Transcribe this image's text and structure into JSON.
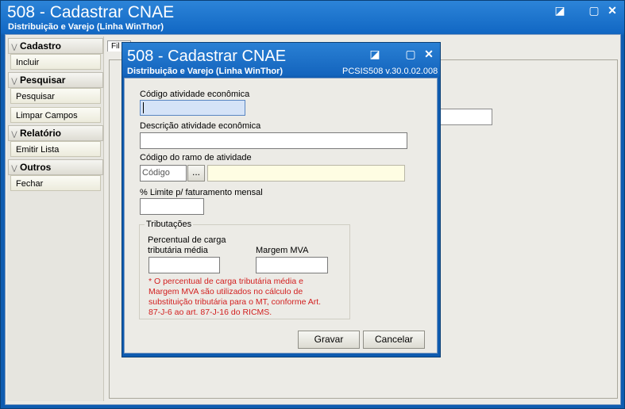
{
  "main_window": {
    "title": "508 - Cadastrar CNAE",
    "subtitle": "Distribuição e Varejo (Linha WinThor)",
    "controls": {
      "restore": "◪",
      "minimize": "▢",
      "close": "✕"
    }
  },
  "sidebar": {
    "groups": [
      {
        "title": "Cadastro",
        "items": [
          "Incluir"
        ]
      },
      {
        "title": "Pesquisar",
        "items": [
          "Pesquisar",
          "Limpar Campos"
        ]
      },
      {
        "title": "Relatório",
        "items": [
          "Emitir Lista"
        ]
      },
      {
        "title": "Outros",
        "items": [
          "Fechar"
        ]
      }
    ]
  },
  "background": {
    "tab_label": "Fil"
  },
  "dialog": {
    "title": "508 - Cadastrar CNAE",
    "subtitle": "Distribuição e Varejo (Linha WinThor)",
    "version": "PCSIS508  v.30.0.02.008",
    "controls": {
      "restore": "◪",
      "minimize": "▢",
      "close": "✕"
    },
    "fields": {
      "codigo_atividade": {
        "label": "Código atividade econômica",
        "value": ""
      },
      "descricao_atividade": {
        "label": "Descrição atividade econômica",
        "value": ""
      },
      "codigo_ramo": {
        "label": "Código do ramo de atividade",
        "placeholder": "Código",
        "lookup_label": "...",
        "desc_value": ""
      },
      "limite_faturamento": {
        "label": "% Limite p/ faturamento mensal",
        "value": ""
      }
    },
    "tributacoes": {
      "legend": "Tributações",
      "percentual_label_1": "Percentual de carga",
      "percentual_label_2": "tributária média",
      "margem_label": "Margem MVA",
      "warning": "* O percentual de carga tributária média e Margem MVA são utilizados no cálculo de substituição tributária para o MT, conforme Art. 87-J-6 ao art. 87-J-16 do RICMS."
    },
    "buttons": {
      "save": "Gravar",
      "cancel": "Cancelar"
    }
  },
  "colors": {
    "title_bar": "#1268c4",
    "client": "#ecebe6",
    "warning": "#d21f1f",
    "highlight_field": "#fefde3"
  }
}
